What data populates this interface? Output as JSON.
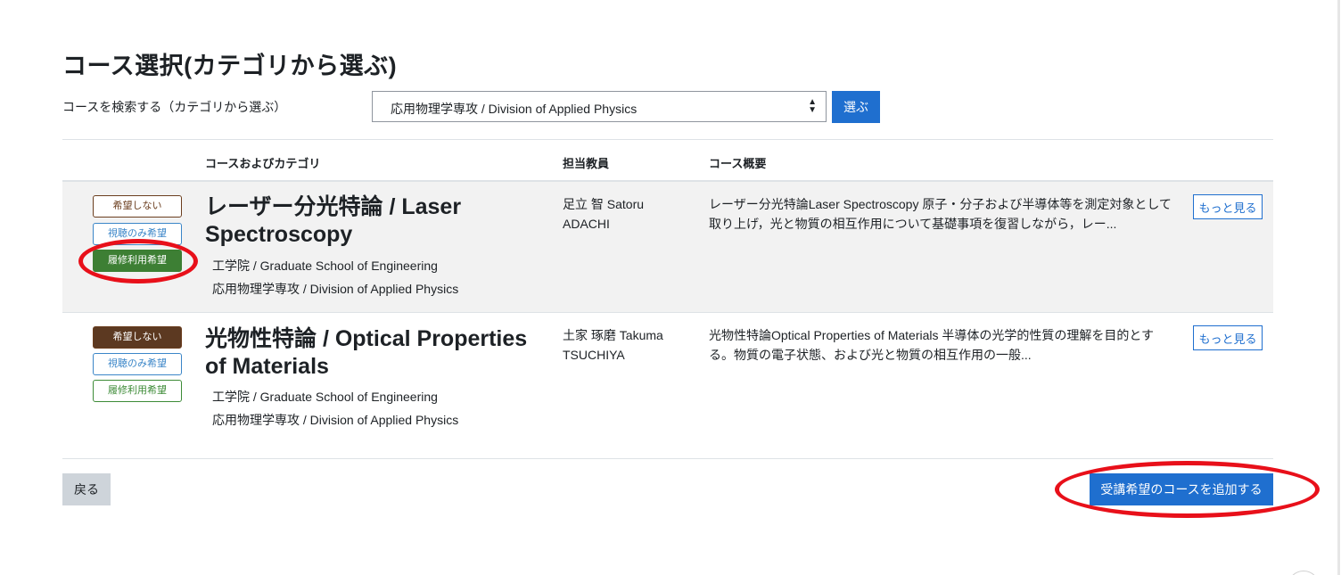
{
  "page": {
    "title": "コース選択(カテゴリから選ぶ)"
  },
  "search": {
    "label": "コースを検索する（カテゴリから選ぶ）",
    "selected_category": "応用物理学専攻 / Division of Applied Physics",
    "go_label": "選ぶ"
  },
  "table": {
    "headers": {
      "course": "コースおよびカテゴリ",
      "teacher": "担当教員",
      "summary": "コース概要"
    },
    "rows": [
      {
        "pref_none": "希望しない",
        "pref_audit": "視聴のみ希望",
        "pref_credit": "履修利用希望",
        "selected_preference": "履修利用希望",
        "title": "レーザー分光特論 / Laser Spectroscopy",
        "faculty": "工学院 / Graduate School of Engineering",
        "division": "応用物理学専攻 / Division of Applied Physics",
        "teacher": "足立 智 Satoru ADACHI",
        "summary": "レーザー分光特論Laser Spectroscopy 原子・分子および半導体等を測定対象として取り上げ，光と物質の相互作用について基礎事項を復習しながら，レー...",
        "more": "もっと見る"
      },
      {
        "pref_none": "希望しない",
        "pref_audit": "視聴のみ希望",
        "pref_credit": "履修利用希望",
        "selected_preference": "希望しない",
        "title": "光物性特論 / Optical Properties of Materials",
        "faculty": "工学院 / Graduate School of Engineering",
        "division": "応用物理学専攻 / Division of Applied Physics",
        "teacher": "土家 琢磨 Takuma TSUCHIYA",
        "summary": "光物性特論Optical Properties of Materials 半導体の光学的性質の理解を目的とする。物質の電子状態、および光と物質の相互作用の一般...",
        "more": "もっと見る"
      }
    ]
  },
  "footer": {
    "back_label": "戻る",
    "add_label": "受講希望のコースを追加する"
  },
  "colors": {
    "primary": "#1f6fcf",
    "pref_none_selected": "#5c3921",
    "pref_credit_selected": "#3d7f34",
    "annotation": "#e8101a"
  }
}
